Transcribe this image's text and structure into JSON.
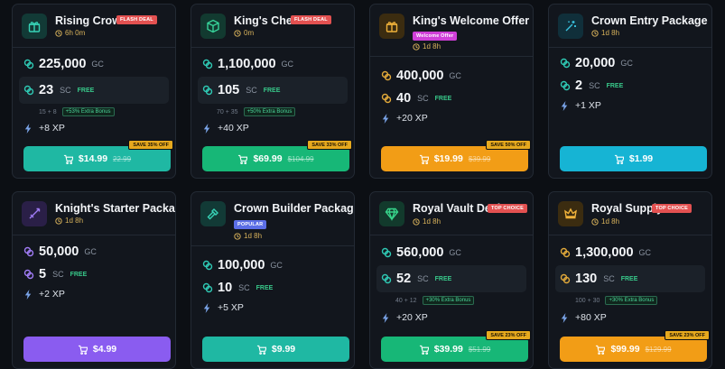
{
  "colors": {
    "teal": "#1fb8a3",
    "green": "#17b777",
    "orange": "#f29d16",
    "cyan": "#16b4d4",
    "purple": "#8a5cf0",
    "coin_gc": "#2fc9b4",
    "coin_sc": "#e0a83a",
    "free_green": "#38c98a"
  },
  "cards": [
    {
      "title": "Rising Crown",
      "badge": "FLASH DEAL",
      "timer": "6h 0m",
      "icon": "gift-icon",
      "gc": "225,000",
      "gc_unit": "GC",
      "sc": "23",
      "sc_unit": "SC",
      "free": "FREE",
      "bonus_calc": "15 + 8",
      "bonus_tag": "+53% Extra Bonus",
      "xp": "+8 XP",
      "price": "$14.99",
      "old_price": "22.99",
      "save": "SAVE 35% OFF"
    },
    {
      "title": "King's Chest",
      "badge": "FLASH DEAL",
      "timer": "0m",
      "icon": "box-icon",
      "gc": "1,100,000",
      "gc_unit": "GC",
      "sc": "105",
      "sc_unit": "SC",
      "free": "FREE",
      "bonus_calc": "70 + 35",
      "bonus_tag": "+50% Extra Bonus",
      "xp": "+40 XP",
      "price": "$69.99",
      "old_price": "$104.99",
      "save": "SAVE 33% OFF"
    },
    {
      "title": "King's Welcome Offer",
      "badge": "Welcome Offer",
      "timer": "1d 8h",
      "icon": "gift-icon",
      "gc": "400,000",
      "gc_unit": "GC",
      "sc": "40",
      "sc_unit": "SC",
      "free": "FREE",
      "xp": "+20 XP",
      "price": "$19.99",
      "old_price": "$39.99",
      "save": "SAVE 50% OFF"
    },
    {
      "title": "Crown Entry Package",
      "timer": "1d 8h",
      "icon": "wand-icon",
      "gc": "20,000",
      "gc_unit": "GC",
      "sc": "2",
      "sc_unit": "SC",
      "free": "FREE",
      "xp": "+1 XP",
      "price": "$1.99"
    },
    {
      "title": "Knight's Starter Package",
      "timer": "1d 8h",
      "icon": "sword-icon",
      "gc": "50,000",
      "gc_unit": "GC",
      "sc": "5",
      "sc_unit": "SC",
      "free": "FREE",
      "xp": "+2 XP",
      "price": "$4.99"
    },
    {
      "title": "Crown Builder Package",
      "badge": "POPULAR",
      "timer": "1d 8h",
      "icon": "hammer-icon",
      "gc": "100,000",
      "gc_unit": "GC",
      "sc": "10",
      "sc_unit": "SC",
      "free": "FREE",
      "xp": "+5 XP",
      "price": "$9.99"
    },
    {
      "title": "Royal Vault Deal",
      "badge": "TOP CHOICE",
      "timer": "1d 8h",
      "icon": "gem-icon",
      "gc": "560,000",
      "gc_unit": "GC",
      "sc": "52",
      "sc_unit": "SC",
      "free": "FREE",
      "bonus_calc": "40 + 12",
      "bonus_tag": "+30% Extra Bonus",
      "xp": "+20 XP",
      "price": "$39.99",
      "old_price": "$51.99",
      "save": "SAVE 23% OFF"
    },
    {
      "title": "Royal Supply",
      "badge": "TOP CHOICE",
      "timer": "1d 8h",
      "icon": "crown-icon",
      "gc": "1,300,000",
      "gc_unit": "GC",
      "sc": "130",
      "sc_unit": "SC",
      "free": "FREE",
      "bonus_calc": "100 + 30",
      "bonus_tag": "+30% Extra Bonus",
      "xp": "+80 XP",
      "price": "$99.99",
      "old_price": "$129.99",
      "save": "SAVE 23% OFF"
    }
  ]
}
